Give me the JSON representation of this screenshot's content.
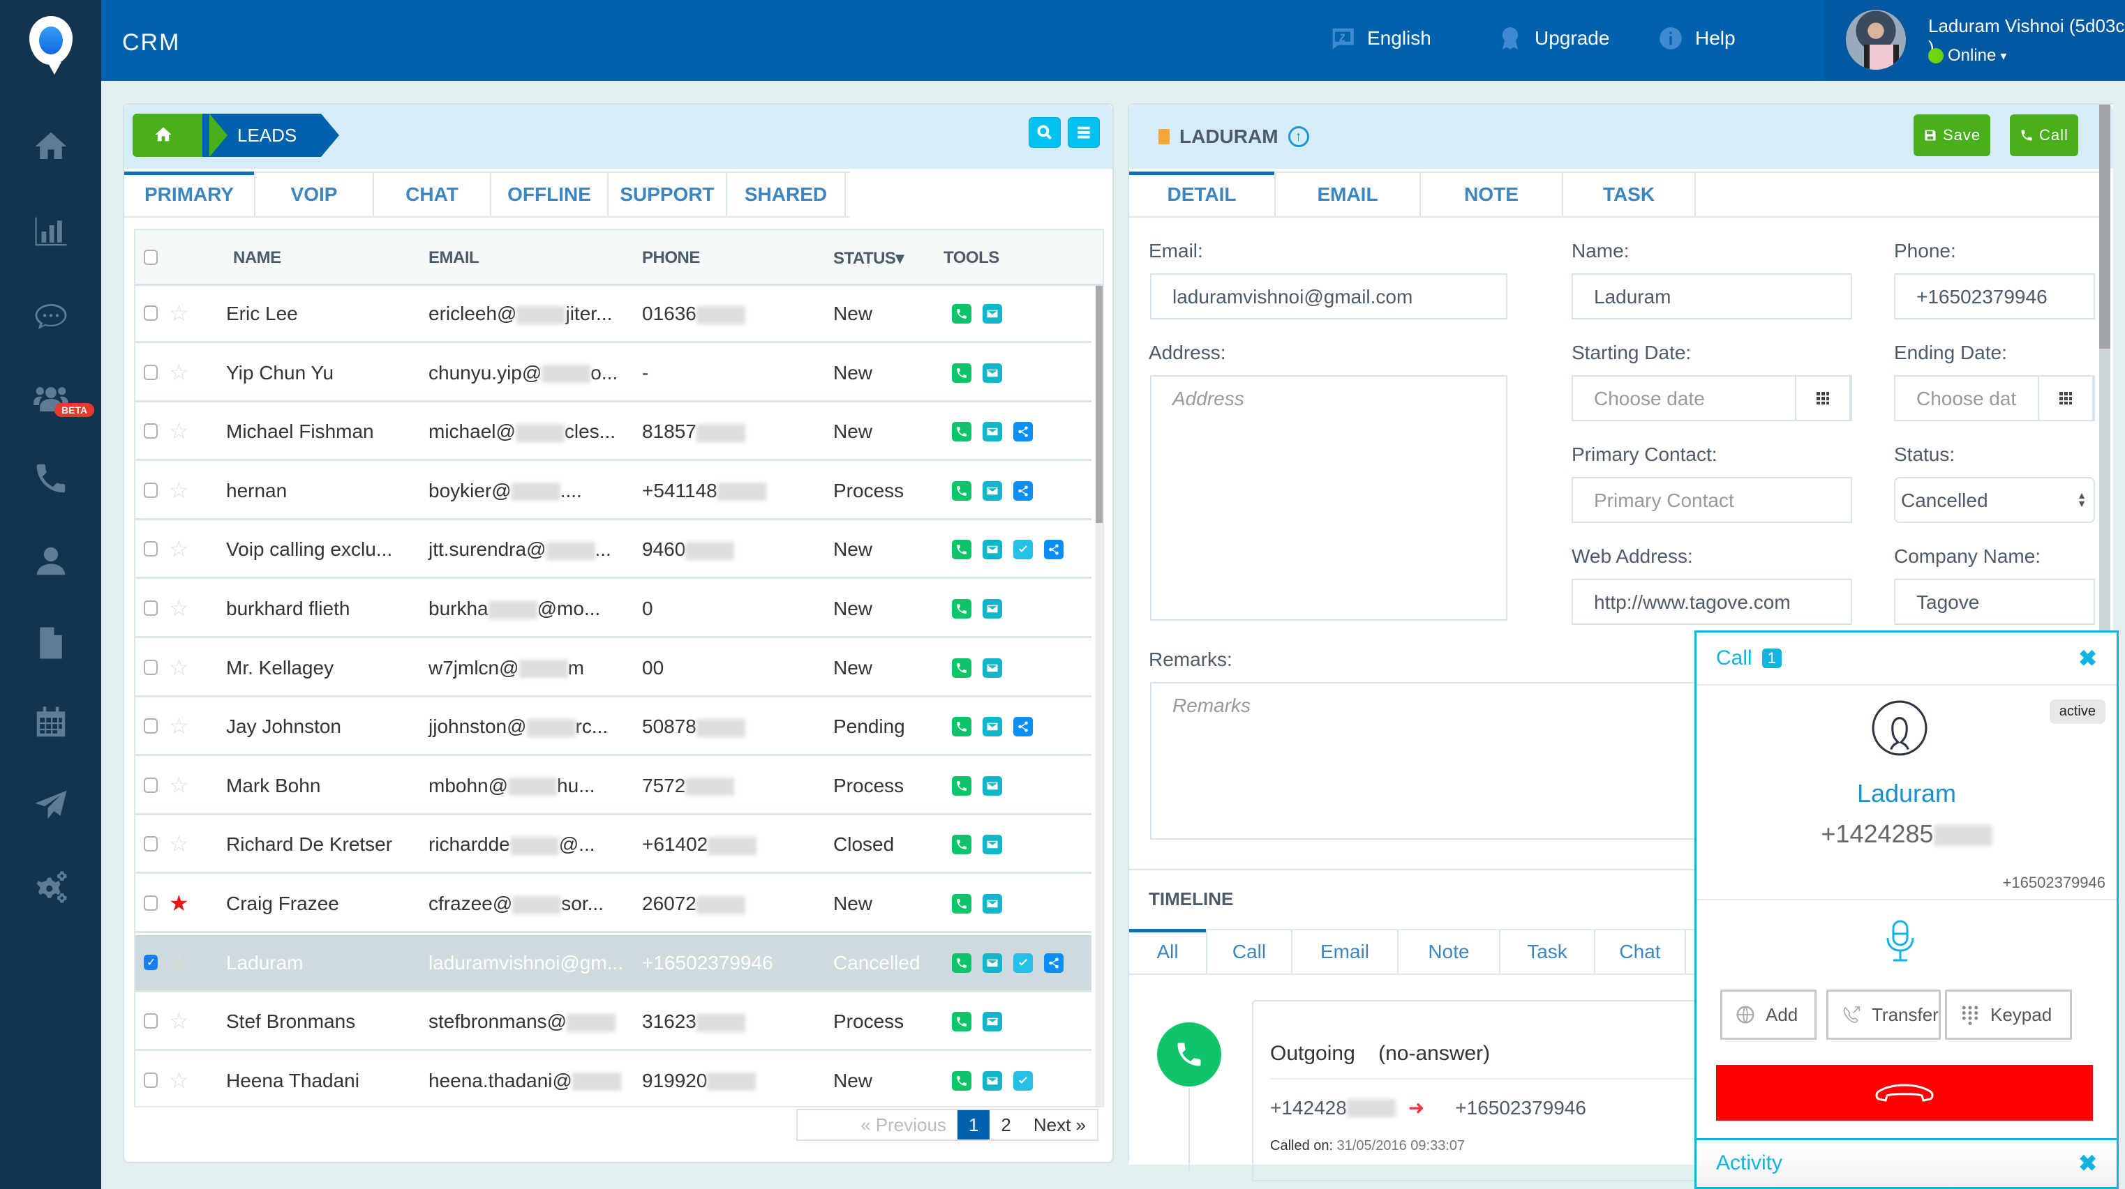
{
  "app": {
    "title": "CRM"
  },
  "topbar": {
    "links": [
      {
        "label": "English",
        "icon": "language-icon"
      },
      {
        "label": "Upgrade",
        "icon": "award-icon"
      },
      {
        "label": "Help",
        "icon": "info-icon"
      }
    ],
    "user": {
      "name": "Laduram Vishnoi (5d03c )",
      "status": "Online",
      "status_caret": "▾",
      "status_color": "#6ed40f"
    }
  },
  "sidebar": {
    "items": [
      {
        "name": "home",
        "icon": "home-icon"
      },
      {
        "name": "reports",
        "icon": "bar-chart-icon"
      },
      {
        "name": "chat",
        "icon": "chat-bubble-icon"
      },
      {
        "name": "team",
        "icon": "users-icon",
        "badge": "BETA"
      },
      {
        "name": "calls",
        "icon": "phone-icon"
      },
      {
        "name": "contacts",
        "icon": "user-icon"
      },
      {
        "name": "documents",
        "icon": "document-icon"
      },
      {
        "name": "calendar",
        "icon": "calendar-icon"
      },
      {
        "name": "campaigns",
        "icon": "paper-plane-icon"
      },
      {
        "name": "settings",
        "icon": "gears-icon"
      }
    ]
  },
  "leads": {
    "breadcrumb": {
      "home_icon": "home-icon",
      "current": "LEADS"
    },
    "tabs": [
      "PRIMARY",
      "VOIP",
      "CHAT",
      "OFFLINE",
      "SUPPORT",
      "SHARED"
    ],
    "active_tab": "PRIMARY",
    "columns": {
      "name": "NAME",
      "email": "EMAIL",
      "phone": "PHONE",
      "status": "STATUS▾",
      "tools": "TOOLS"
    },
    "rows": [
      {
        "name": "Eric Lee",
        "email_pre": "ericleeh@",
        "email_post": "jiter...",
        "phone": "01636",
        "phone_blur": true,
        "status": "New",
        "starred": false,
        "selected": false,
        "tools": [
          "call",
          "mail"
        ]
      },
      {
        "name": "Yip Chun Yu",
        "email_pre": "chunyu.yip@",
        "email_post": "o...",
        "phone": "-",
        "phone_blur": false,
        "status": "New",
        "starred": false,
        "selected": false,
        "tools": [
          "call",
          "mail"
        ]
      },
      {
        "name": "Michael Fishman",
        "email_pre": "michael@",
        "email_post": "cles...",
        "phone": "81857",
        "phone_blur": true,
        "status": "New",
        "starred": false,
        "selected": false,
        "tools": [
          "call",
          "mail",
          "share"
        ]
      },
      {
        "name": "hernan",
        "email_pre": "boykier@",
        "email_post": "....",
        "phone": "+541148",
        "phone_blur": true,
        "status": "Process",
        "starred": false,
        "selected": false,
        "tools": [
          "call",
          "mail",
          "share"
        ]
      },
      {
        "name": "Voip calling exclu...",
        "email_pre": "jtt.surendra@",
        "email_post": "...",
        "phone": "9460",
        "phone_blur": true,
        "status": "New",
        "starred": false,
        "selected": false,
        "tools": [
          "call",
          "mail",
          "task",
          "share"
        ]
      },
      {
        "name": "burkhard flieth",
        "email_pre": "burkha",
        "email_post": "@mo...",
        "phone": "0",
        "phone_blur": false,
        "status": "New",
        "starred": false,
        "selected": false,
        "tools": [
          "call",
          "mail"
        ]
      },
      {
        "name": "Mr. Kellagey",
        "email_pre": "w7jmlcn@",
        "email_post": "m",
        "phone": "00",
        "phone_blur": false,
        "status": "New",
        "starred": false,
        "selected": false,
        "tools": [
          "call",
          "mail"
        ]
      },
      {
        "name": "Jay Johnston",
        "email_pre": "jjohnston@",
        "email_post": "rc...",
        "phone": "50878",
        "phone_blur": true,
        "status": "Pending",
        "starred": false,
        "selected": false,
        "tools": [
          "call",
          "mail",
          "share"
        ]
      },
      {
        "name": "Mark Bohn",
        "email_pre": "mbohn@",
        "email_post": "hu...",
        "phone": "7572",
        "phone_blur": true,
        "status": "Process",
        "starred": false,
        "selected": false,
        "tools": [
          "call",
          "mail"
        ]
      },
      {
        "name": "Richard De Kretser",
        "email_pre": "richardde",
        "email_post": "@...",
        "phone": "+61402",
        "phone_blur": true,
        "status": "Closed",
        "starred": false,
        "selected": false,
        "tools": [
          "call",
          "mail"
        ]
      },
      {
        "name": "Craig Frazee",
        "email_pre": "cfrazee@",
        "email_post": "sor...",
        "phone": "26072",
        "phone_blur": true,
        "status": "New",
        "starred": true,
        "selected": false,
        "tools": [
          "call",
          "mail"
        ]
      },
      {
        "name": "Laduram",
        "email_pre": "laduramvishnoi@gm...",
        "email_post": "",
        "phone": "+16502379946",
        "phone_blur": false,
        "status": "Cancelled",
        "starred": false,
        "selected": true,
        "tools": [
          "call",
          "mail",
          "task",
          "share"
        ]
      },
      {
        "name": "Stef Bronmans",
        "email_pre": "stefbronmans@",
        "email_post": "",
        "phone": "31623",
        "phone_blur": true,
        "status": "Process",
        "starred": false,
        "selected": false,
        "tools": [
          "call",
          "mail"
        ]
      },
      {
        "name": "Heena Thadani",
        "email_pre": "heena.thadani@",
        "email_post": "",
        "phone": "919920",
        "phone_blur": true,
        "status": "New",
        "starred": false,
        "selected": false,
        "tools": [
          "call",
          "mail",
          "task"
        ]
      }
    ],
    "pagination": {
      "previous": "« Previous",
      "pages": [
        "1",
        "2"
      ],
      "current": "1",
      "next": "Next »"
    }
  },
  "detail": {
    "title": "LADURAM",
    "save_label": "Save",
    "call_label": "Call",
    "tabs": [
      "DETAIL",
      "EMAIL",
      "NOTE",
      "TASK"
    ],
    "active_tab": "DETAIL",
    "fields": {
      "email": {
        "label": "Email:",
        "value": "laduramvishnoi@gmail.com"
      },
      "name": {
        "label": "Name:",
        "value": "Laduram"
      },
      "phone": {
        "label": "Phone:",
        "value": "+16502379946"
      },
      "address": {
        "label": "Address:",
        "placeholder": "Address"
      },
      "starting_date": {
        "label": "Starting Date:",
        "placeholder": "Choose date"
      },
      "ending_date": {
        "label": "Ending Date:",
        "placeholder": "Choose dat"
      },
      "primary_contact": {
        "label": "Primary Contact:",
        "placeholder": "Primary Contact"
      },
      "status": {
        "label": "Status:",
        "value": "Cancelled"
      },
      "web_address": {
        "label": "Web Address:",
        "value": "http://www.tagove.com"
      },
      "company_name": {
        "label": "Company Name:",
        "value": "Tagove"
      },
      "remarks": {
        "label": "Remarks:",
        "placeholder": "Remarks"
      }
    },
    "timeline": {
      "title": "TIMELINE",
      "tabs": [
        "All",
        "Call",
        "Email",
        "Note",
        "Task",
        "Chat"
      ],
      "active_tab": "All",
      "entry": {
        "type": "Outgoing",
        "result": "(no-answer)",
        "from": "+142428",
        "to": "+16502379946",
        "called_on_label": "Called on:",
        "called_on": "31/05/2016 09:33:07"
      }
    }
  },
  "call_widget": {
    "title": "Call",
    "count": "1",
    "state": "active",
    "contact_name": "Laduram",
    "number": "+1424285",
    "caller_id": "+16502379946",
    "actions": [
      "Add",
      "Transfer",
      "Keypad"
    ],
    "hangup_color": "#fe0000",
    "activity_label": "Activity"
  }
}
